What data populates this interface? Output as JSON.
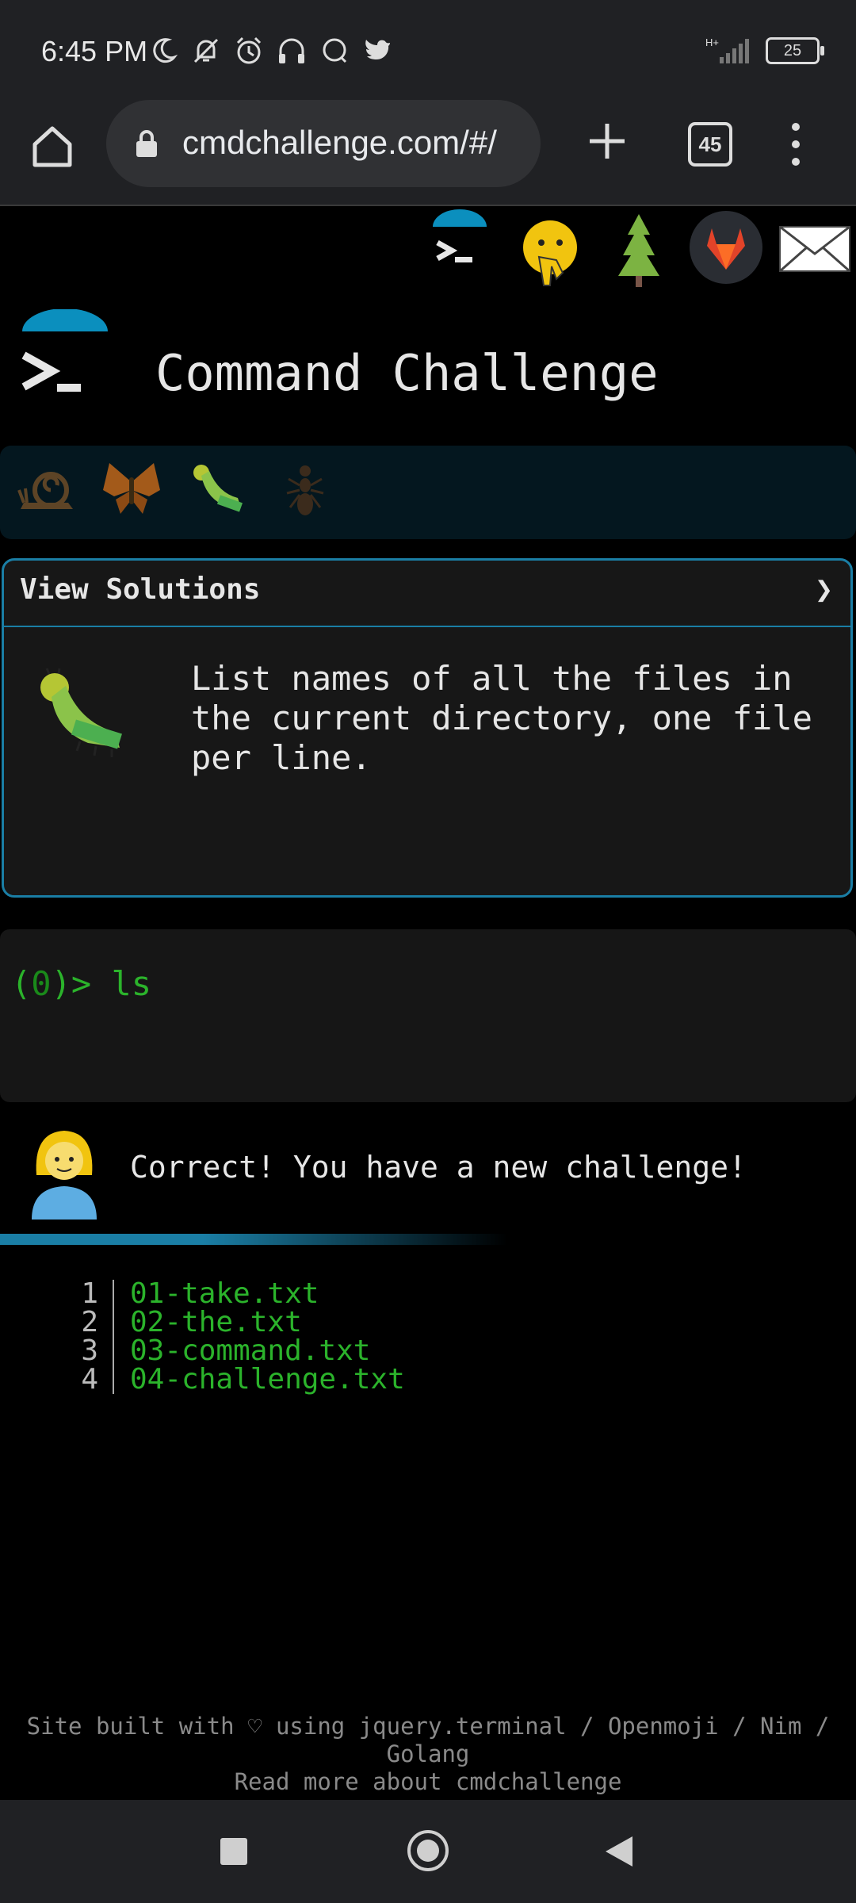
{
  "status_bar": {
    "time": "6:45 PM",
    "network": "H+",
    "battery": "25",
    "icons": [
      "moon-icon",
      "bell-off-icon",
      "alarm-icon",
      "headphones-icon",
      "chat-icon",
      "twitter-icon"
    ]
  },
  "browser": {
    "url": "cmdchallenge.com/#/",
    "tab_count": "45"
  },
  "page": {
    "header_icons": [
      "terminal-logo-icon",
      "shushing-face-icon",
      "tree-icon",
      "gitlab-icon",
      "mail-icon"
    ],
    "title": "Command Challenge",
    "levels": [
      "snail-icon",
      "butterfly-icon",
      "caterpillar-icon",
      "ant-icon"
    ],
    "solutions": {
      "header": "View Solutions",
      "chevron": "❯",
      "challenge_text": "List names of all the files in the current directory, one file per line."
    },
    "terminal": {
      "prompt_open": "(",
      "prompt_num": "0",
      "prompt_close": ")> ",
      "command": "ls"
    },
    "feedback": "Correct! You have a new challenge!",
    "output": [
      {
        "line": "1",
        "text": "01-take.txt"
      },
      {
        "line": "2",
        "text": "02-the.txt"
      },
      {
        "line": "3",
        "text": "03-command.txt"
      },
      {
        "line": "4",
        "text": "04-challenge.txt"
      }
    ],
    "footer": {
      "line1": "Site built with ♡ using jquery.terminal / Openmoji / Nim /",
      "line2": "Golang",
      "line3": "Read more about cmdchallenge"
    }
  },
  "colors": {
    "accent": "#1a7ea5",
    "terminal_green": "#2bb32b",
    "background": "#000000"
  }
}
